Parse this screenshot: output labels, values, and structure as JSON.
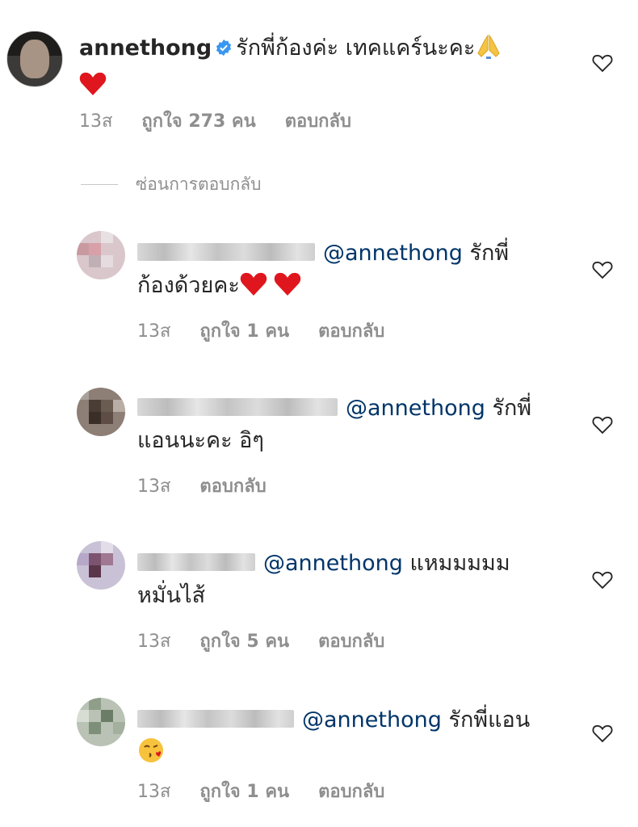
{
  "main_comment": {
    "username": "annethong",
    "text": "รักพี่ก้องค่ะ เทคแคร์นะคะ",
    "time": "13ส",
    "likes": "ถูกใจ 273 คน",
    "reply": "ตอบกลับ"
  },
  "hide_replies_label": "ซ่อนการตอบกลับ",
  "replies": [
    {
      "mention": "@annethong",
      "text_line1": "รักพี่",
      "text_line2": "ก้องด้วยคะ",
      "time": "13ส",
      "likes": "ถูกใจ 1 คน",
      "reply": "ตอบกลับ"
    },
    {
      "mention": "@annethong",
      "text_line1": "รักพี่",
      "text_line2": "แอนนะคะ อิๆ",
      "time": "13ส",
      "reply": "ตอบกลับ"
    },
    {
      "mention": "@annethong",
      "text_line1": "แหมมมมม",
      "text_line2": "หมั่นไส้",
      "time": "13ส",
      "likes": "ถูกใจ 5 คน",
      "reply": "ตอบกลับ"
    },
    {
      "mention": "@annethong",
      "text_line1": "รักพี่แอน",
      "time": "13ส",
      "likes": "ถูกใจ 1 คน",
      "reply": "ตอบกลับ"
    }
  ],
  "colors": {
    "mention": "#003569",
    "meta": "#8e8e8e",
    "verified": "#3897f0"
  },
  "icons": {
    "like": "heart-outline-icon",
    "verified": "verified-badge-icon"
  }
}
